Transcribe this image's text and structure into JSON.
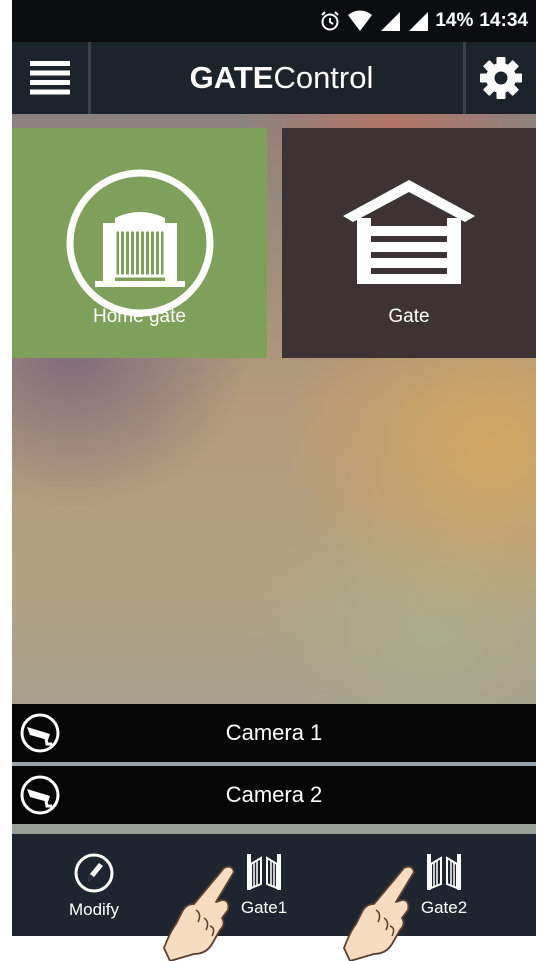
{
  "status_bar": {
    "battery_percent": "14%",
    "time": "14:34",
    "icons": [
      "alarm-icon",
      "wifi-icon",
      "signal-icon",
      "signal-icon"
    ]
  },
  "app_bar": {
    "title_bold": "GATE",
    "title_light": "Control",
    "menu_icon": "hamburger-menu-icon",
    "settings_icon": "gear-icon"
  },
  "tiles": [
    {
      "label": "Home gate",
      "icon": "swing-gate-icon",
      "color": "#7fa05a"
    },
    {
      "label": "Gate",
      "icon": "garage-icon",
      "color": "#3d3335"
    }
  ],
  "cameras": [
    {
      "label": "Camera 1",
      "icon": "security-camera-icon"
    },
    {
      "label": "Camera 2",
      "icon": "security-camera-icon"
    }
  ],
  "bottom_nav": [
    {
      "label": "Modify",
      "icon": "pencil-icon"
    },
    {
      "label": "Gate1",
      "icon": "gate-open-icon"
    },
    {
      "label": "Gate2",
      "icon": "gate-open-icon"
    }
  ],
  "colors": {
    "accent_green": "#7fa05a",
    "tile_dark": "#3d3335",
    "bar_dark": "#1f2530"
  }
}
